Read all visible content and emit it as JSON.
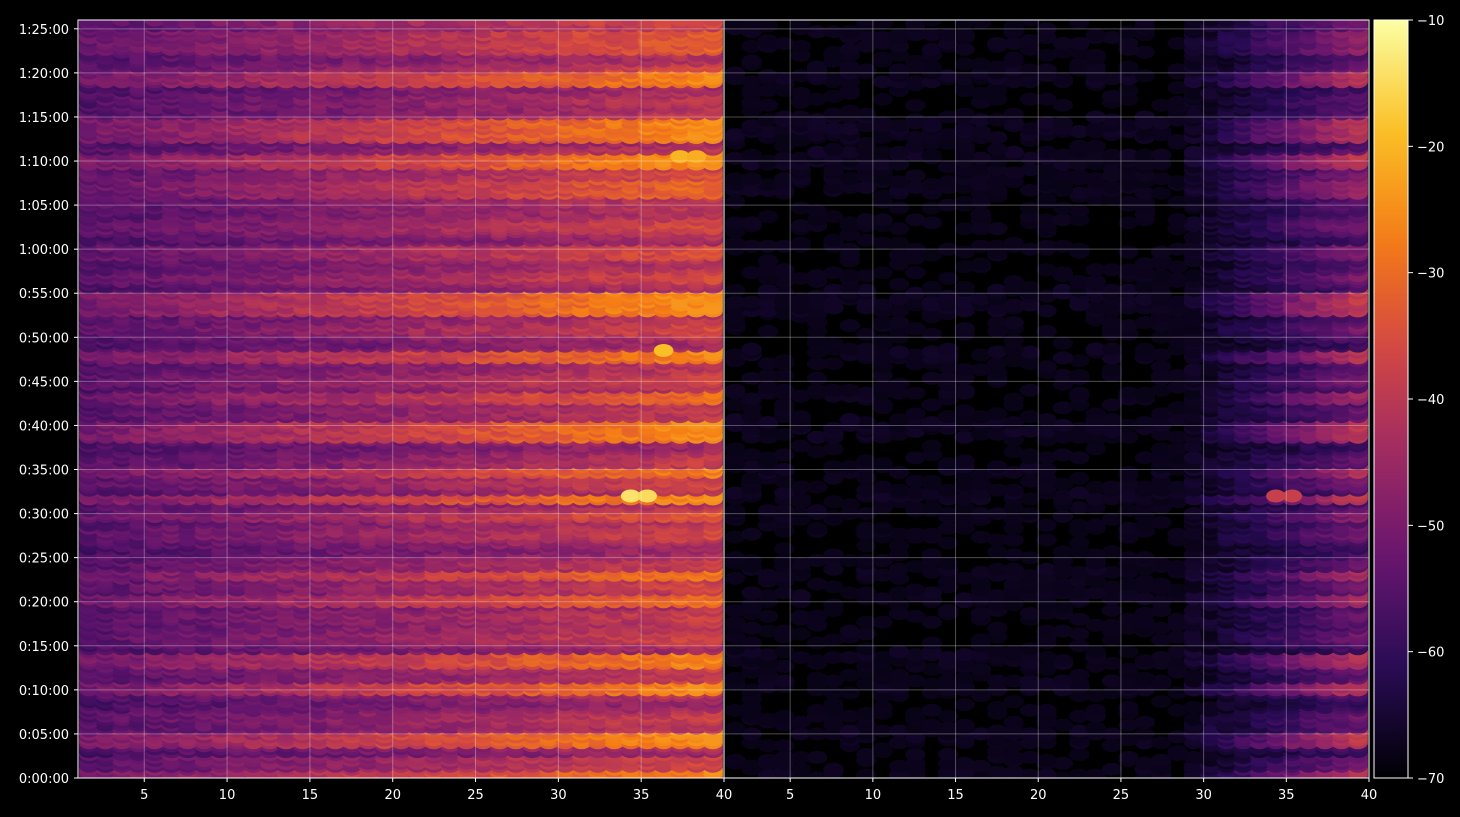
{
  "chart_data": {
    "type": "heatmap",
    "title": "",
    "colormap": "inferno",
    "background": "#000000",
    "grid": true,
    "grid_color": "#ffffff",
    "y_axis": {
      "label": "",
      "range_seconds": [
        0,
        5160
      ],
      "ticks": [
        {
          "seconds": 0,
          "label": "0:00:00"
        },
        {
          "seconds": 300,
          "label": "0:05:00"
        },
        {
          "seconds": 600,
          "label": "0:10:00"
        },
        {
          "seconds": 900,
          "label": "0:15:00"
        },
        {
          "seconds": 1200,
          "label": "0:20:00"
        },
        {
          "seconds": 1500,
          "label": "0:25:00"
        },
        {
          "seconds": 1800,
          "label": "0:30:00"
        },
        {
          "seconds": 2100,
          "label": "0:35:00"
        },
        {
          "seconds": 2400,
          "label": "0:40:00"
        },
        {
          "seconds": 2700,
          "label": "0:45:00"
        },
        {
          "seconds": 3000,
          "label": "0:50:00"
        },
        {
          "seconds": 3300,
          "label": "0:55:00"
        },
        {
          "seconds": 3600,
          "label": "1:00:00"
        },
        {
          "seconds": 3900,
          "label": "1:05:00"
        },
        {
          "seconds": 4200,
          "label": "1:10:00"
        },
        {
          "seconds": 4500,
          "label": "1:15:00"
        },
        {
          "seconds": 4800,
          "label": "1:20:00"
        },
        {
          "seconds": 5100,
          "label": "1:25:00"
        }
      ]
    },
    "panels": [
      {
        "name": "",
        "x_range": [
          1,
          40
        ],
        "x_ticks": [
          "5",
          "10",
          "15",
          "20",
          "25",
          "30",
          "35",
          "40"
        ],
        "x_tick_values": [
          5,
          10,
          15,
          20,
          25,
          30,
          35,
          40
        ],
        "base_range_db": [
          -68,
          -24
        ],
        "activity": "high"
      },
      {
        "name": "",
        "x_range": [
          1,
          40
        ],
        "x_ticks": [
          "5",
          "10",
          "15",
          "20",
          "25",
          "30",
          "35",
          "40"
        ],
        "x_tick_values": [
          5,
          10,
          15,
          20,
          25,
          30,
          35,
          40
        ],
        "base_range_db": [
          -70,
          -36
        ],
        "activity": "low_except_upper_bins"
      }
    ],
    "hot_spots": [
      {
        "panel": 0,
        "bin": 34,
        "seconds": 1920,
        "value": -14
      },
      {
        "panel": 0,
        "bin": 35,
        "seconds": 1920,
        "value": -15
      },
      {
        "panel": 0,
        "bin": 37,
        "seconds": 4230,
        "value": -20
      },
      {
        "panel": 0,
        "bin": 38,
        "seconds": 4230,
        "value": -21
      },
      {
        "panel": 0,
        "bin": 36,
        "seconds": 2910,
        "value": -19
      },
      {
        "panel": 1,
        "bin": 34,
        "seconds": 1920,
        "value": -38
      },
      {
        "panel": 1,
        "bin": 35,
        "seconds": 1920,
        "value": -38
      }
    ],
    "colorbar": {
      "range": [
        -70,
        -10
      ],
      "ticks": [
        {
          "value": -10,
          "label": "−10"
        },
        {
          "value": -20,
          "label": "−20"
        },
        {
          "value": -30,
          "label": "−30"
        },
        {
          "value": -40,
          "label": "−40"
        },
        {
          "value": -50,
          "label": "−50"
        },
        {
          "value": -60,
          "label": "−60"
        },
        {
          "value": -70,
          "label": "−70"
        }
      ]
    }
  }
}
